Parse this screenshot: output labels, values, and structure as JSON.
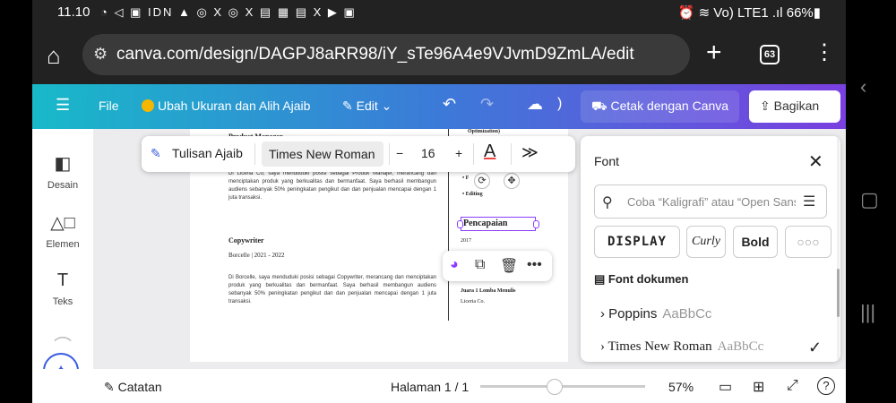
{
  "status": {
    "time": "11.10",
    "icons": "◔ ◁ ▣ IDN ▲ ◎ X ◎ X ▤ ▦ ▤ X ▶ ▣",
    "right": "⏰ ≋ Vo) LTE1 .ıl 66%▮"
  },
  "browser": {
    "url": "canva.com/design/DAGPJ8aRR98/iY_sTe96A4e9VJvmD9ZmLA/edit",
    "tab_count": "63"
  },
  "toolbar": {
    "menu": "☰",
    "file": "File",
    "resize": "Ubah Ukuran dan Alih Ajaib",
    "edit": "Edit",
    "print": "Cetak dengan Canva",
    "share": "Bagikan"
  },
  "sidebar": {
    "items": [
      {
        "label": "Desain",
        "icon": "design-icon"
      },
      {
        "label": "Elemen",
        "icon": "elements-icon"
      },
      {
        "label": "Teks",
        "icon": "text-icon"
      }
    ]
  },
  "text_toolbar": {
    "magic_write": "Tulisan Ajaib",
    "font": "Times New Roman",
    "minus": "−",
    "size": "16",
    "plus": "+",
    "color_letter": "A",
    "more": "≫"
  },
  "document": {
    "job1_title": "Product Manager",
    "job1_para": "Di Liceria Co, saya menduduki posisi sebagai Produk Manajer, merancang dan menciptakan produk yang berkualitas dan bermanfaat. Saya berhasil membangun audiens sebanyak 50% peningkatan pengikut dan dan penjualan mencapai dengan 1 juta transaksi.",
    "job2_title": "Copywriter",
    "job2_meta": "Borcelle | 2021 - 2022",
    "job2_para": "Di Borcelle, saya menduduki posisi sebagai Copywriter, merancang dan menciptakan produk yang berkualitas dan bermanfaat. Saya berhasil membangun audiens sebanyak 50% peningkatan pengikut dan dan penjualan mencapai dengan 1 juta transaksi.",
    "right_top": "Optimization)",
    "bullet1": "• F",
    "bullet2": "• Editing",
    "pencapaian": "Pencapaian",
    "year1": "2017",
    "year2": "2017",
    "award": "Juara 1 Lomba Menulis",
    "award_org": "Liceria Co."
  },
  "font_panel": {
    "title": "Font",
    "search_placeholder": "Coba “Kaligrafi” atau “Open Sans”",
    "chips": [
      "DISPLAY",
      "Curly",
      "Bold",
      "○○○"
    ],
    "section": "Font dokumen",
    "fonts": [
      {
        "name": "Poppins",
        "sample": "AaBbCc",
        "selected": false
      },
      {
        "name": "Times New Roman",
        "sample": "AaBbCc",
        "selected": true
      }
    ]
  },
  "bottom": {
    "notes": "Catatan",
    "page": "Halaman 1 / 1",
    "zoom": "57%",
    "zoom_level": 0.57
  }
}
